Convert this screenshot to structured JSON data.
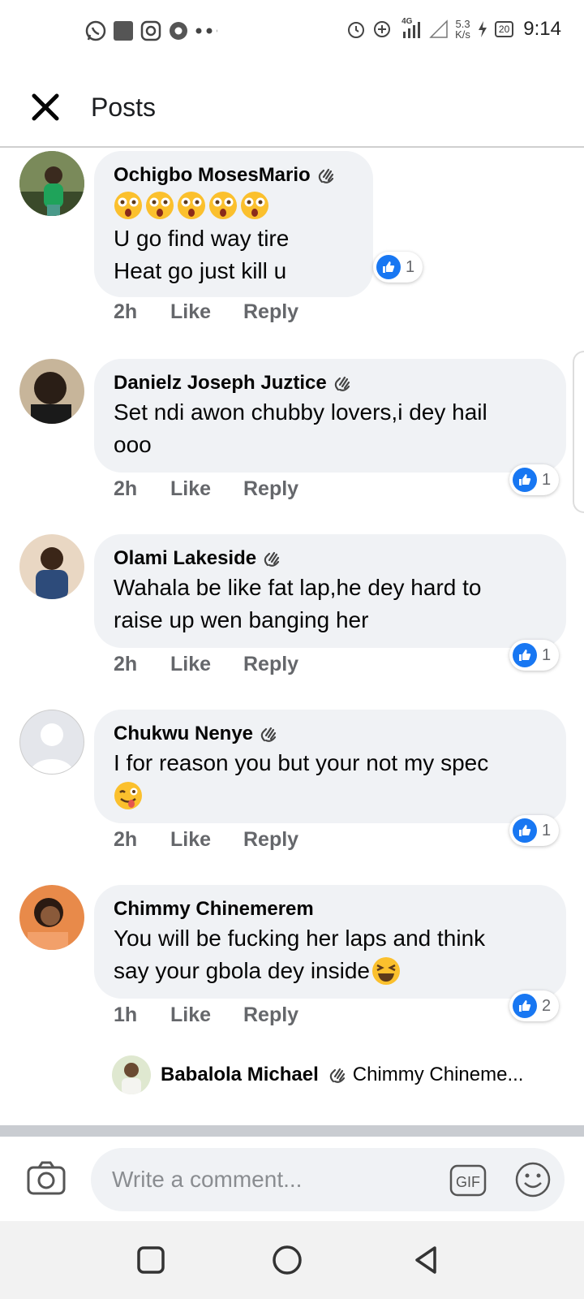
{
  "status_bar": {
    "time": "9:14",
    "network": "4G",
    "speed_top": "5.3",
    "speed_bottom": "K/s",
    "battery": "20"
  },
  "header": {
    "title": "Posts"
  },
  "comments": [
    {
      "author": "Ochigbo MosesMario",
      "text_line1": "U go find way tire",
      "text_line2": "Heat go just kill u",
      "time": "2h",
      "like": "Like",
      "reply": "Reply",
      "reactions": "1"
    },
    {
      "author": "Danielz Joseph Juztice",
      "text_line1": "Set ndi awon chubby lovers,i dey hail",
      "text_line2": "ooo",
      "time": "2h",
      "like": "Like",
      "reply": "Reply",
      "reactions": "1"
    },
    {
      "author": "Olami Lakeside",
      "text_line1": "Wahala be like fat lap,he dey hard to",
      "text_line2": "raise up wen banging her",
      "time": "2h",
      "like": "Like",
      "reply": "Reply",
      "reactions": "1"
    },
    {
      "author": "Chukwu Nenye",
      "text_line1": "I for reason you but your not my spec",
      "text_line2": "",
      "time": "2h",
      "like": "Like",
      "reply": "Reply",
      "reactions": "1"
    },
    {
      "author": "Chimmy Chinemerem",
      "text_line1": "You will be fucking her laps and think",
      "text_line2": "say your gbola dey inside",
      "time": "1h",
      "like": "Like",
      "reply": "Reply",
      "reactions": "2"
    }
  ],
  "reply_preview": {
    "author": "Babalola Michael",
    "text": "Chimmy Chineme..."
  },
  "composer": {
    "placeholder": "Write a comment..."
  },
  "colors": {
    "facebook_blue": "#1877f2",
    "bubble_bg": "#f0f2f5",
    "meta_gray": "#65676b"
  }
}
